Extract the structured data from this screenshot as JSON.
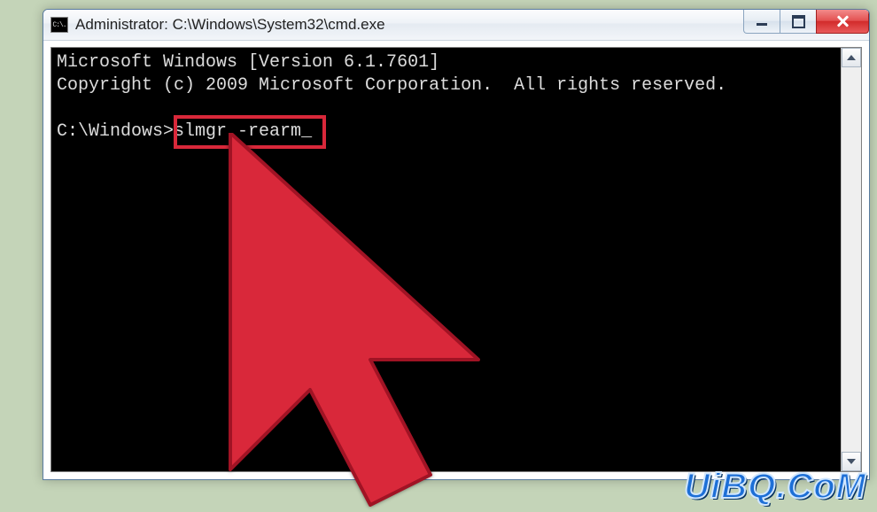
{
  "window": {
    "title": "Administrator: C:\\Windows\\System32\\cmd.exe",
    "icon_label": "C:\\."
  },
  "console": {
    "line1": "Microsoft Windows [Version 6.1.7601]",
    "line2": "Copyright (c) 2009 Microsoft Corporation.  All rights reserved.",
    "blank": "",
    "prompt_prefix": "C:\\Windows>",
    "command": "slmgr -rearm",
    "cursor": "_"
  },
  "watermark": "UiBQ.CoM"
}
